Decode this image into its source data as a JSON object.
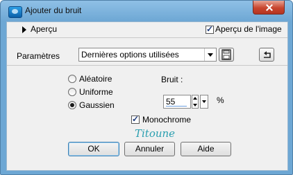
{
  "window": {
    "title": "Ajouter du bruit"
  },
  "preview": {
    "toggle_label": "Aperçu",
    "checkbox_label": "Aperçu de l'image",
    "checked": true
  },
  "parameters": {
    "label": "Paramètres",
    "preset_value": "Dernières options utilisées"
  },
  "distribution": {
    "options": [
      {
        "label": "Aléatoire",
        "selected": false
      },
      {
        "label": "Uniforme",
        "selected": false
      },
      {
        "label": "Gaussien",
        "selected": true
      }
    ]
  },
  "noise": {
    "label": "Bruit :",
    "value": "55",
    "unit": "%"
  },
  "monochrome": {
    "label": "Monochrome",
    "checked": true
  },
  "watermark": {
    "text": "Titoune"
  },
  "buttons": {
    "ok": "OK",
    "cancel": "Annuler",
    "help": "Aide"
  },
  "colors": {
    "title_bar": "#7bb3de",
    "client_bg": "#f0f0f0",
    "close_button": "#c8452e",
    "signature": "#2a9fb0"
  }
}
